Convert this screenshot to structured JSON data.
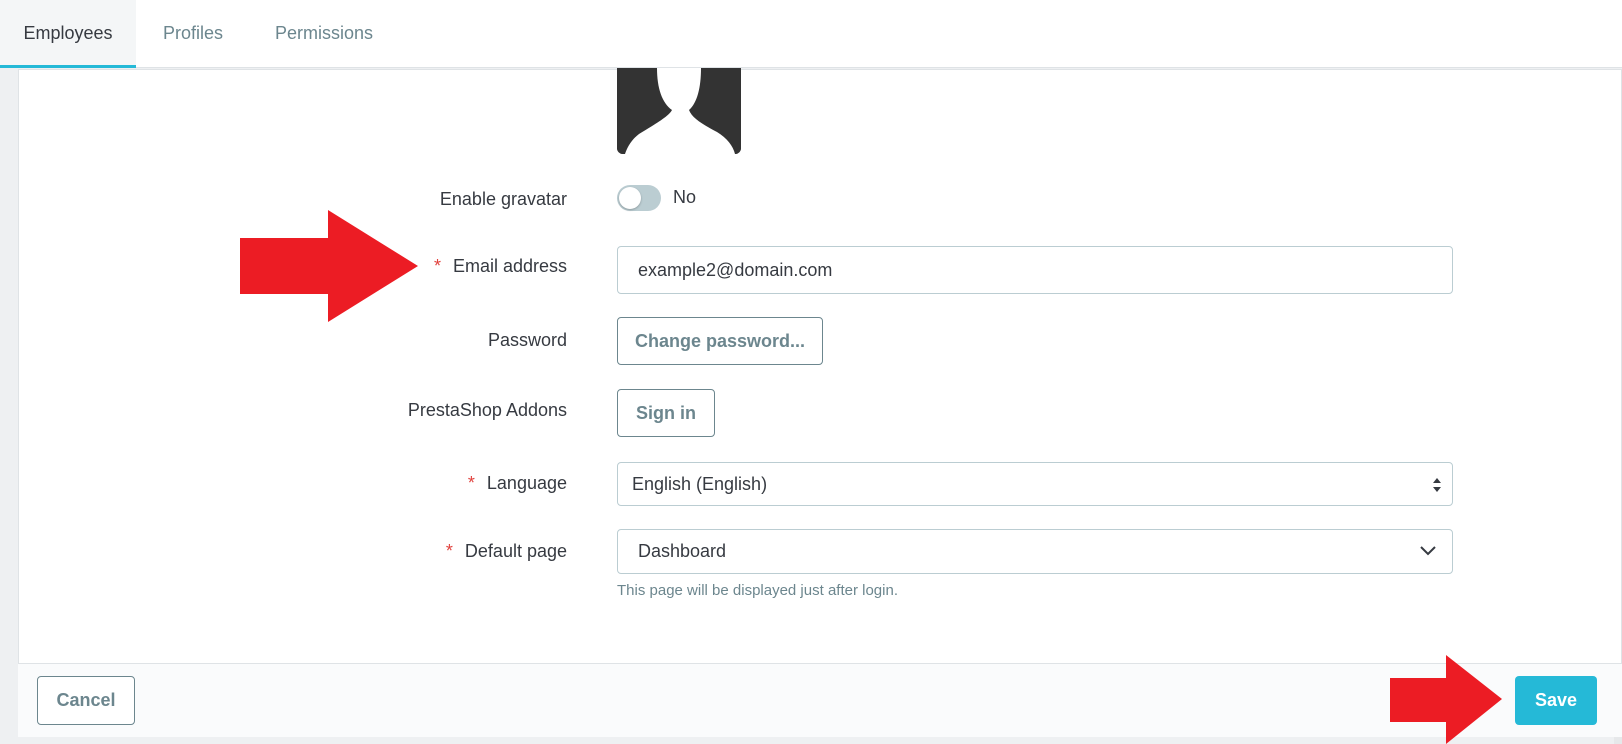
{
  "tabs": [
    {
      "label": "Employees",
      "active": true
    },
    {
      "label": "Profiles",
      "active": false
    },
    {
      "label": "Permissions",
      "active": false
    }
  ],
  "form": {
    "gravatar": {
      "label": "Enable gravatar",
      "state": "No",
      "enabled": false
    },
    "email": {
      "label": "Email address",
      "required_mark": "*",
      "value": "example2@domain.com"
    },
    "password": {
      "label": "Password",
      "button": "Change password..."
    },
    "addons": {
      "label": "PrestaShop Addons",
      "button": "Sign in"
    },
    "language": {
      "label": "Language",
      "required_mark": "*",
      "value": "English (English)"
    },
    "default_page": {
      "label": "Default page",
      "required_mark": "*",
      "value": "Dashboard",
      "help": "This page will be displayed just after login."
    }
  },
  "footer": {
    "cancel_label": "Cancel",
    "save_label": "Save"
  },
  "icons": {
    "arrow_color": "#ec1c24",
    "accent": "#25b9d7"
  }
}
